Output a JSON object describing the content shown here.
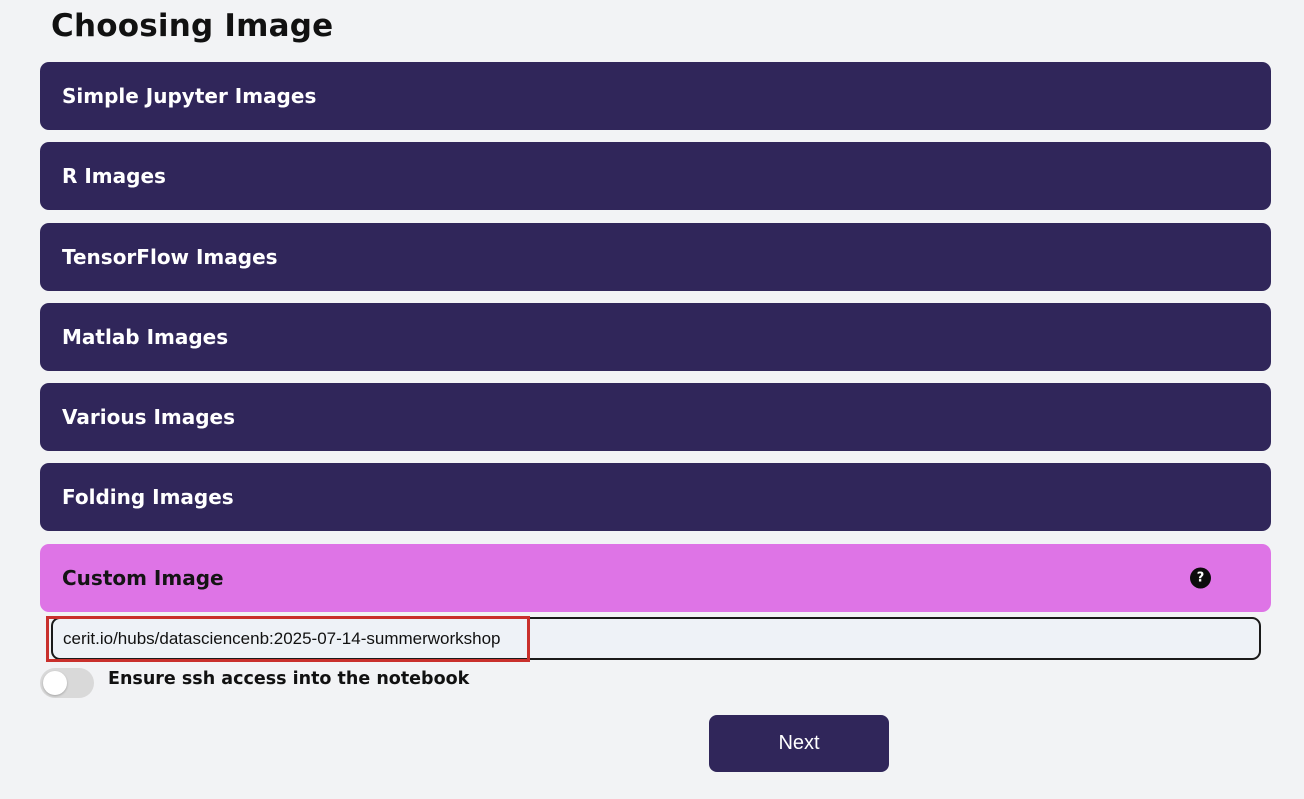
{
  "page": {
    "title": "Choosing Image"
  },
  "accordion": {
    "items": [
      {
        "label": "Simple Jupyter Images"
      },
      {
        "label": "R Images"
      },
      {
        "label": "TensorFlow Images"
      },
      {
        "label": "Matlab Images"
      },
      {
        "label": "Various Images"
      },
      {
        "label": "Folding Images"
      },
      {
        "label": "Custom Image",
        "active": true,
        "help_icon": "question-circle-icon",
        "help_glyph": "?"
      }
    ]
  },
  "custom_image": {
    "value": "cerit.io/hubs/datasciencenb:2025-07-14-summerworkshop"
  },
  "ssh_toggle": {
    "label": "Ensure ssh access into the notebook",
    "enabled": false
  },
  "actions": {
    "next_label": "Next"
  },
  "colors": {
    "panel": "#30265a",
    "active_panel": "#de74e6",
    "highlight": "#c9302c",
    "background": "#f2f3f5"
  }
}
